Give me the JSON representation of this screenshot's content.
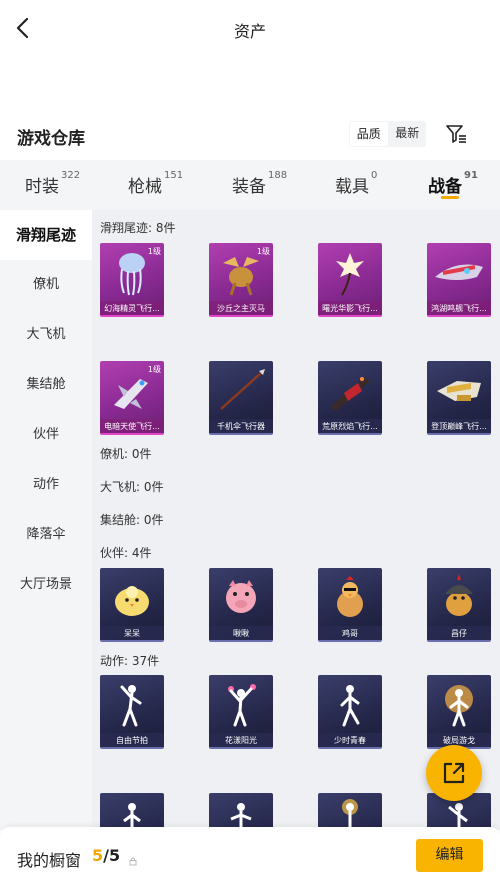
{
  "header": {
    "title": "资产"
  },
  "section": {
    "title": "游戏仓库",
    "sort_options": [
      "品质",
      "最新"
    ]
  },
  "tabs": [
    {
      "label": "时装",
      "count": "322"
    },
    {
      "label": "枪械",
      "count": "151"
    },
    {
      "label": "装备",
      "count": "188"
    },
    {
      "label": "载具",
      "count": "0"
    },
    {
      "label": "战备",
      "count": "91"
    }
  ],
  "sidebar": {
    "items": [
      "滑翔尾迹",
      "僚机",
      "大飞机",
      "集结舱",
      "伙伴",
      "动作",
      "降落伞",
      "大厅场景"
    ]
  },
  "groups": [
    {
      "label": "滑翔尾迹: 8件"
    },
    {
      "label": "僚机: 0件"
    },
    {
      "label": "大飞机: 0件"
    },
    {
      "label": "集结舱: 0件"
    },
    {
      "label": "伙伴: 4件"
    },
    {
      "label": "动作: 37件"
    }
  ],
  "trails": [
    {
      "name": "幻海精灵飞行...",
      "level": "1级",
      "icon": "jellyfish-icon"
    },
    {
      "name": "沙丘之主灭马",
      "level": "1级",
      "icon": "winged-horse-icon"
    },
    {
      "name": "曙光华影飞行...",
      "level": "",
      "icon": "flower-icon"
    },
    {
      "name": "鸿湖鸣舰飞行...",
      "level": "",
      "icon": "spaceship-icon"
    },
    {
      "name": "电暗天使飞行...",
      "level": "1级",
      "icon": "jet-icon"
    },
    {
      "name": "千机伞飞行器",
      "level": "",
      "icon": "spear-icon"
    },
    {
      "name": "荒原烈焰飞行...",
      "level": "",
      "icon": "gun-glider-icon"
    },
    {
      "name": "登顶巅峰飞行...",
      "level": "",
      "icon": "gold-ship-icon"
    }
  ],
  "companions": [
    {
      "name": "呆呆",
      "icon": "yellow-chick-icon"
    },
    {
      "name": "啾啾",
      "icon": "pink-pig-icon"
    },
    {
      "name": "鸡哥",
      "icon": "rooster-icon"
    },
    {
      "name": "昌仔",
      "icon": "helmet-chick-icon"
    }
  ],
  "emotes": [
    {
      "name": "自由节拍",
      "icon": "dance-icon"
    },
    {
      "name": "花漾阳光",
      "icon": "cheer-icon"
    },
    {
      "name": "少时青春",
      "icon": "stride-icon"
    },
    {
      "name": "破局游戈",
      "icon": "burst-icon"
    }
  ],
  "bottom": {
    "label": "我的橱窗",
    "current": "5",
    "total": "/5",
    "edit": "编辑"
  },
  "colors": {
    "accent": "#f8b400",
    "purple_card": "#9a3299",
    "navy_card": "#2a2c52"
  }
}
